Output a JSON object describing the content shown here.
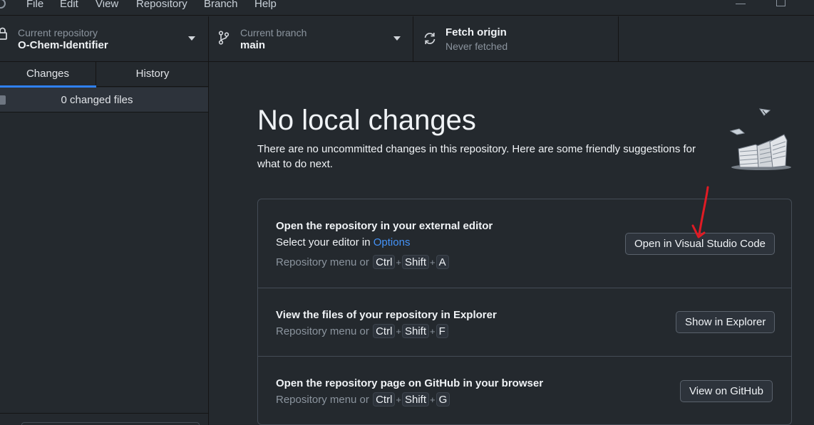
{
  "menu": {
    "items": [
      "File",
      "Edit",
      "View",
      "Repository",
      "Branch",
      "Help"
    ]
  },
  "toolbar": {
    "repo_label": "Current repository",
    "repo_value": "O-Chem-Identifier",
    "branch_label": "Current branch",
    "branch_value": "main",
    "fetch_label": "Fetch origin",
    "fetch_sub": "Never fetched"
  },
  "sidebar": {
    "tabs": [
      "Changes",
      "History"
    ],
    "changed_files": "0 changed files"
  },
  "main": {
    "title": "No local changes",
    "subtitle": "There are no uncommitted changes in this repository. Here are some friendly suggestions for what to do next.",
    "suggestions": [
      {
        "title": "Open the repository in your external editor",
        "desc_prefix": "Select your editor in ",
        "desc_link": "Options",
        "shortcut_prefix": "Repository menu or",
        "keys": [
          "Ctrl",
          "Shift",
          "A"
        ],
        "button": "Open in Visual Studio Code"
      },
      {
        "title": "View the files of your repository in Explorer",
        "shortcut_prefix": "Repository menu or",
        "keys": [
          "Ctrl",
          "Shift",
          "F"
        ],
        "button": "Show in Explorer"
      },
      {
        "title": "Open the repository page on GitHub in your browser",
        "shortcut_prefix": "Repository menu or",
        "keys": [
          "Ctrl",
          "Shift",
          "G"
        ],
        "button": "View on GitHub"
      }
    ]
  },
  "colors": {
    "background": "#24292e",
    "accent": "#2f81f7",
    "link": "#4493f8",
    "annotation": "#e01b24"
  }
}
